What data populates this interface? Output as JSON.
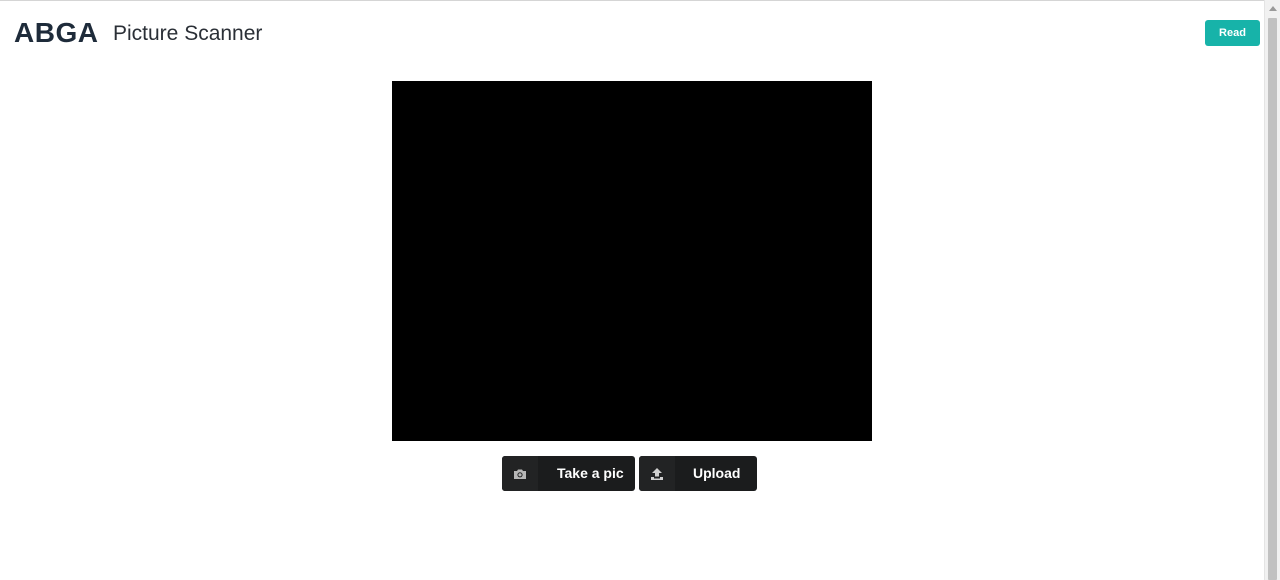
{
  "header": {
    "logo": "ABGA",
    "title": "Picture Scanner",
    "read_label": "Read"
  },
  "colors": {
    "accent": "#17b3a9",
    "logo": "#1e2b3a",
    "button_dark": "#1b1c1d",
    "preview": "#000000"
  },
  "actions": {
    "take_pic": {
      "label": "Take a pic",
      "icon": "camera-icon"
    },
    "upload": {
      "label": "Upload",
      "icon": "upload-icon"
    }
  }
}
